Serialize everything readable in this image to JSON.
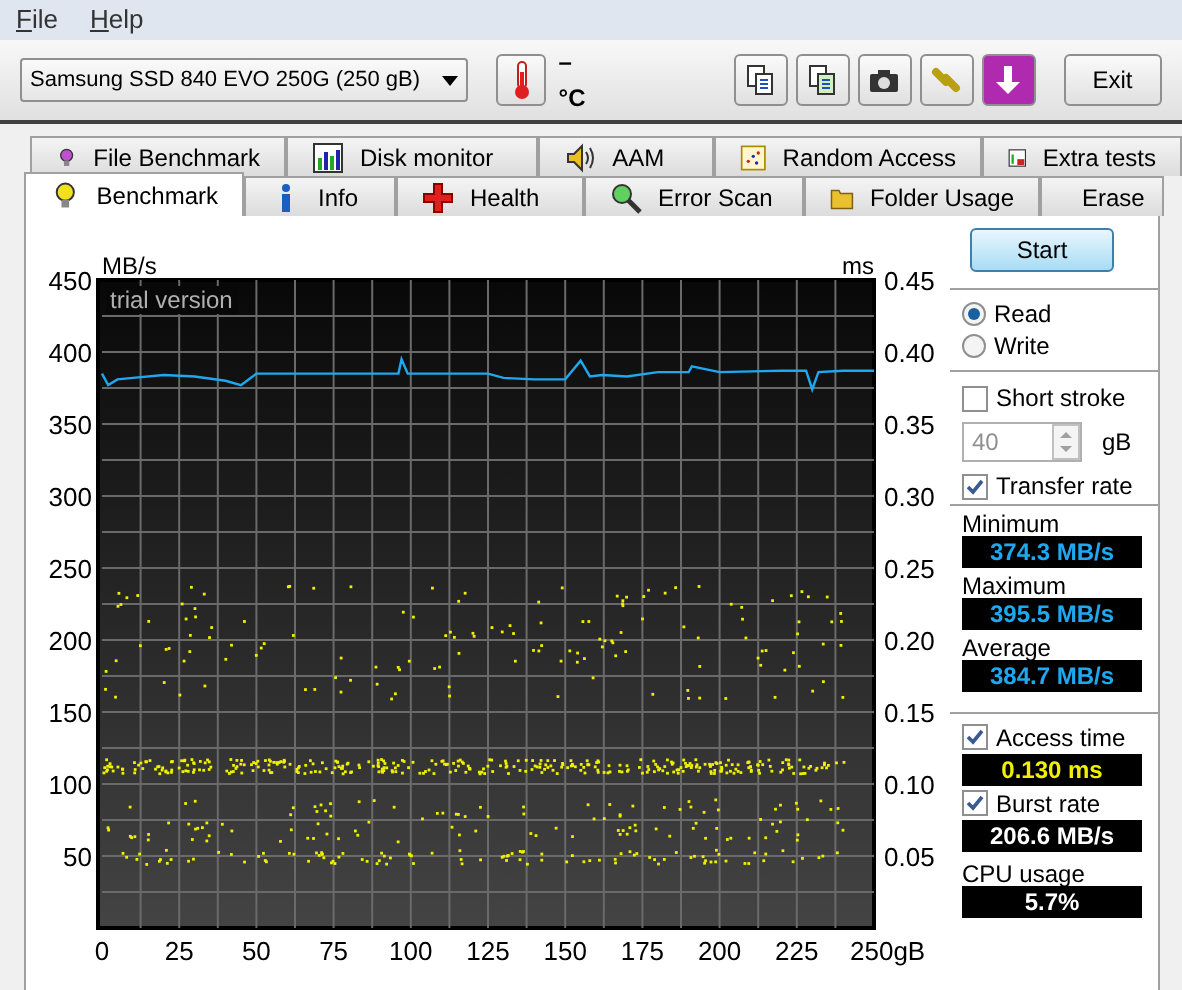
{
  "menu": [
    "File",
    "Help"
  ],
  "toolbar": {
    "drive": "Samsung SSD 840 EVO 250G (250 gB)",
    "temperature": "– °C",
    "exit": "Exit"
  },
  "tabs": [
    [
      {
        "label": "File Benchmark",
        "selected": false
      },
      {
        "label": "Disk monitor",
        "selected": false
      },
      {
        "label": "AAM",
        "selected": false
      },
      {
        "label": "Random Access",
        "selected": false
      },
      {
        "label": "Extra tests",
        "selected": false
      }
    ],
    [
      {
        "label": "Benchmark",
        "selected": true
      },
      {
        "label": "Info",
        "selected": false
      },
      {
        "label": "Health",
        "selected": false
      },
      {
        "label": "Error Scan",
        "selected": false
      },
      {
        "label": "Folder Usage",
        "selected": false
      },
      {
        "label": "Erase",
        "selected": false
      }
    ]
  ],
  "chart": {
    "watermark": "trial version",
    "right_unit": "ms",
    "right_ticks": [
      "0.45",
      "0.40",
      "0.35",
      "0.30",
      "0.25",
      "0.20",
      "0.15",
      "0.10",
      "0.05"
    ],
    "chart_data": {
      "type": "line",
      "ylabel": "MB/s",
      "grid": true,
      "xlim": [
        0,
        250
      ],
      "ylim": [
        0,
        450
      ],
      "xticks": [
        0,
        25,
        50,
        75,
        100,
        125,
        150,
        175,
        200,
        {
          "value": 225,
          "label": "225"
        },
        {
          "value": 250,
          "label": "250gB"
        }
      ],
      "yticks": [
        50,
        100,
        150,
        200,
        250,
        300,
        350,
        400,
        450
      ],
      "x": [
        0,
        2,
        5,
        10,
        20,
        30,
        40,
        45,
        50,
        60,
        70,
        80,
        90,
        96,
        97,
        99,
        110,
        125,
        130,
        140,
        150,
        155,
        158,
        162,
        170,
        180,
        190,
        191,
        200,
        220,
        228,
        230,
        232,
        240,
        250
      ],
      "series": [
        {
          "color": "#1ea8f0",
          "values": [
            385,
            377,
            381,
            382,
            384,
            383,
            380,
            377,
            385,
            385,
            385,
            385,
            385,
            385,
            395,
            385,
            385,
            385,
            382,
            381,
            381,
            394,
            383,
            384,
            383,
            386,
            386,
            390,
            386,
            387,
            387,
            374,
            386,
            387,
            387
          ]
        }
      ]
    }
  },
  "controls": {
    "start": "Start",
    "modes": [
      {
        "label": "Read",
        "selected": true
      },
      {
        "label": "Write",
        "selected": false
      }
    ],
    "short_stroke": {
      "label": "Short stroke",
      "checked": false,
      "value": "40",
      "unit": "gB",
      "disabled": true
    },
    "transfer_rate": {
      "label": "Transfer rate",
      "checked": true
    },
    "readouts": [
      {
        "label": "Minimum",
        "value": "374.3 MB/s"
      },
      {
        "label": "Maximum",
        "value": "395.5 MB/s"
      },
      {
        "label": "Average",
        "value": "384.7 MB/s"
      }
    ],
    "access_time": {
      "label": "Access time",
      "checked": true,
      "value": "0.130 ms"
    },
    "burst_rate": {
      "label": "Burst rate",
      "checked": true,
      "value": "206.6 MB/s"
    },
    "cpu": {
      "label": "CPU usage",
      "value": "5.7%"
    }
  }
}
